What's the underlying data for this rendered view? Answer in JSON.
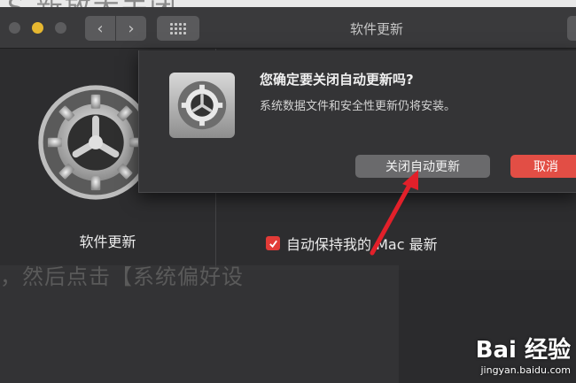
{
  "background": {
    "top_text": "S 新放大关闭 …",
    "line_text": "，然后点击【系统偏好设"
  },
  "window": {
    "title": "软件更新",
    "nav_back": "‹",
    "nav_forward": "›"
  },
  "left_pane": {
    "label": "软件更新",
    "icon": "gear-icon"
  },
  "auto_update": {
    "checked": true,
    "label": "自动保持我的 Mac 最新"
  },
  "dialog": {
    "title": "您确定要关闭自动更新吗?",
    "message": "系统数据文件和安全性更新仍将安装。",
    "confirm_label": "关闭自动更新",
    "cancel_label": "取消"
  },
  "watermark": {
    "brand": "Bai 经验",
    "url": "jingyan.baidu.com"
  },
  "colors": {
    "accent_red": "#e24e45",
    "arrow_red": "#e2202a",
    "minimize_yellow": "#e6b730"
  }
}
